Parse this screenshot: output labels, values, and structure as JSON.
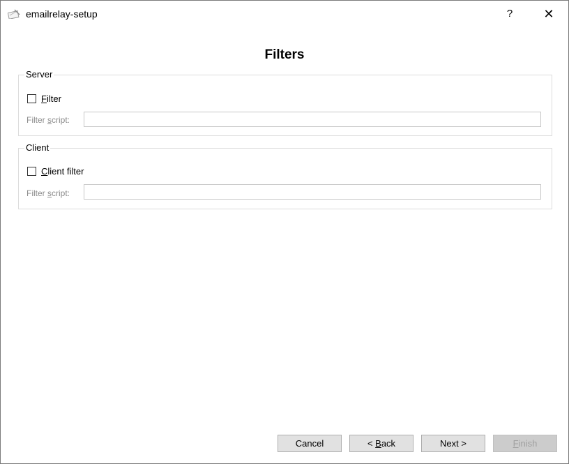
{
  "window": {
    "title": "emailrelay-setup",
    "help_label": "?",
    "close_label": "✕"
  },
  "page": {
    "title": "Filters"
  },
  "server_group": {
    "legend": "Server",
    "checkbox": {
      "prefix": "",
      "mnemonic": "F",
      "rest": "ilter",
      "checked": false
    },
    "script_label": {
      "prefix": "Filter ",
      "mnemonic": "s",
      "rest": "cript:"
    },
    "script_value": ""
  },
  "client_group": {
    "legend": "Client",
    "checkbox": {
      "prefix": "",
      "mnemonic": "C",
      "rest": "lient filter",
      "checked": false
    },
    "script_label": {
      "prefix": "Filter ",
      "mnemonic": "s",
      "rest": "cript:"
    },
    "script_value": ""
  },
  "buttons": {
    "cancel": "Cancel",
    "back": {
      "prefix": "< ",
      "mnemonic": "B",
      "rest": "ack"
    },
    "next": "Next >",
    "finish": {
      "prefix": "",
      "mnemonic": "F",
      "rest": "inish",
      "enabled": false
    }
  },
  "icons": {
    "app": "envelope-pen-icon",
    "help": "question-mark-icon",
    "close": "close-icon"
  }
}
